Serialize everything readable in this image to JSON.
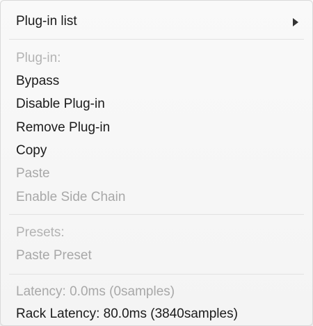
{
  "menu": {
    "plugin_list": {
      "label": "Plug-in list",
      "has_submenu": true
    },
    "plugin_header": "Plug-in:",
    "bypass": "Bypass",
    "disable_plugin": "Disable Plug-in",
    "remove_plugin": "Remove Plug-in",
    "copy": "Copy",
    "paste": "Paste",
    "enable_side_chain": "Enable Side Chain",
    "presets_header": "Presets:",
    "paste_preset": "Paste Preset",
    "latency": "Latency: 0.0ms (0samples)",
    "rack_latency": "Rack Latency: 80.0ms (3840samples)"
  },
  "colors": {
    "enabled_text": "#1b1b1b",
    "disabled_text": "#a8a8a8",
    "separator": "#e2e2e2",
    "background": "#f7f7f7"
  },
  "icons": {
    "submenu": "chevron-right-icon"
  }
}
